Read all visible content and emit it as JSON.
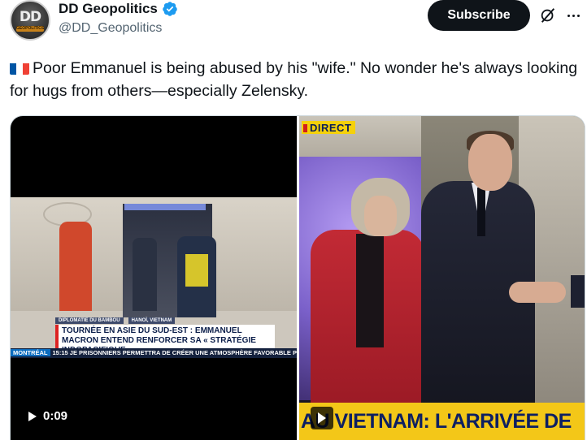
{
  "author": {
    "display_name": "DD Geopolitics",
    "handle": "@DD_Geopolitics",
    "avatar_text": "DD",
    "avatar_band": "GEOPOLITICS",
    "verified_color": "#1d9bf0"
  },
  "actions": {
    "subscribe_label": "Subscribe",
    "grok_icon": "grok-icon",
    "more_icon": "more-icon"
  },
  "post": {
    "flag": "france-flag",
    "text": "Poor Emmanuel is being abused by his \"wife.\" No wonder he's always looking for hugs from others—especially Zelensky."
  },
  "video_left": {
    "tag1": "DIPLOMATIE DU BAMBOU",
    "tag2": "HANOÏ, VIETNAM",
    "headline": "TOURNÉE EN ASIE DU SUD-EST : EMMANUEL MACRON ENTEND RENFORCER SA « STRATÉGIE INDOPACIFIQUE »",
    "ticker_station": "MONTRÉAL",
    "ticker_time": "15:15",
    "ticker_text": "JE PRISONNIERS PERMETTRA DE CRÉER UNE ATMOSPHÈRE FAVORABLE POUR A",
    "duration": "0:09"
  },
  "video_right": {
    "live_label": "DIRECT",
    "banner": "AU VIETNAM: L'ARRIVÉE DE"
  },
  "colors": {
    "banner_yellow": "#f3c718",
    "banner_text": "#0d1f62",
    "coat_red": "#c22a35"
  }
}
